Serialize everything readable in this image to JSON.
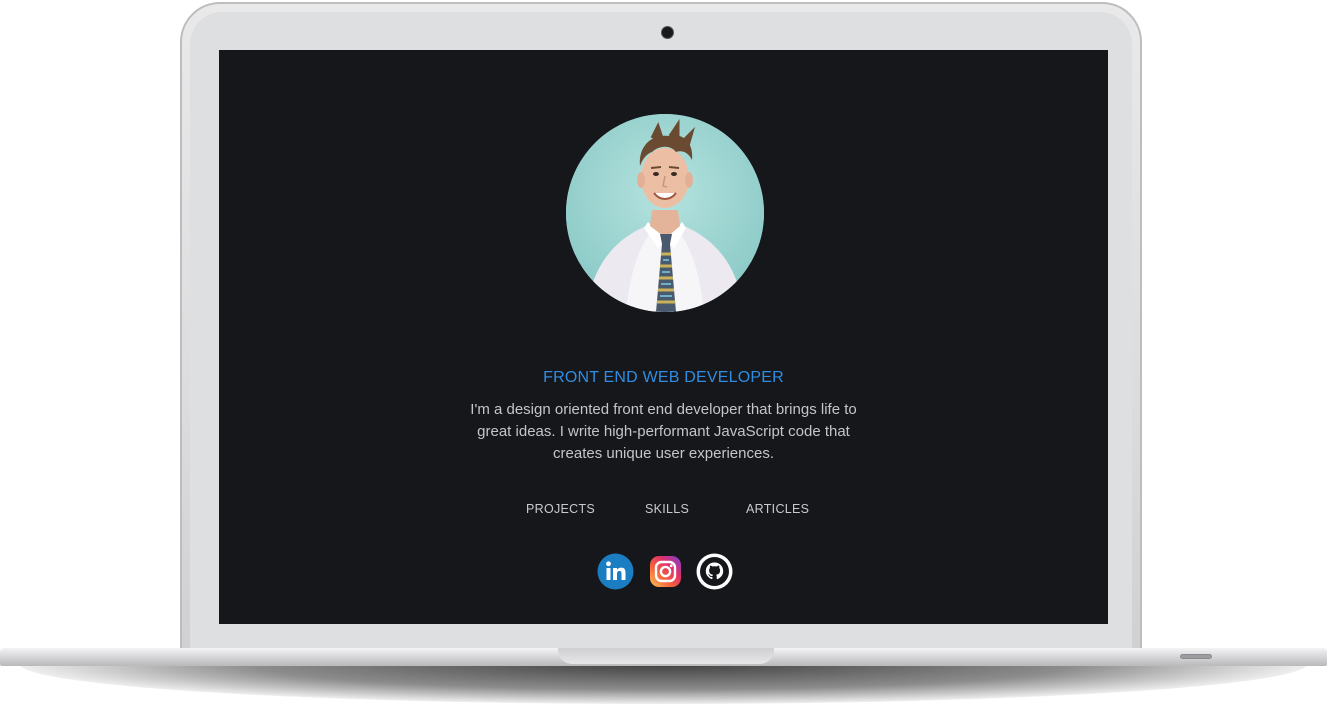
{
  "profile": {
    "title": "FRONT END WEB DEVELOPER",
    "bio": "I'm a design oriented front end developer that brings life to great ideas. I write high-performant JavaScript code that creates unique user experiences.",
    "avatar_icon": "profile-photo"
  },
  "nav": {
    "projects": "PROJECTS",
    "skills": "SKILLS",
    "articles": "ARTICLES"
  },
  "social": [
    {
      "icon": "linkedin-icon",
      "color": "#1b7ec2"
    },
    {
      "icon": "instagram-icon",
      "color": "#e1306c"
    },
    {
      "icon": "github-icon",
      "color": "#ffffff"
    }
  ],
  "colors": {
    "screen_bg": "#16171b",
    "accent": "#2f8de4",
    "text": "#c4c5c9"
  }
}
